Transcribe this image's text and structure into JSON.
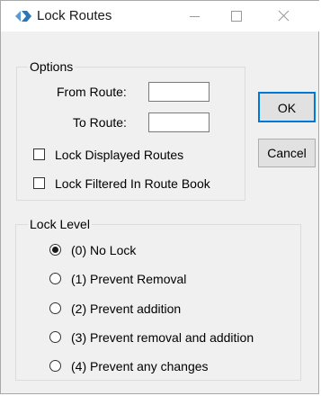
{
  "window": {
    "title": "Lock Routes",
    "icon": "diamond-arrow-icon",
    "controls": {
      "minimize": "minimize-icon",
      "maximize": "maximize-icon",
      "close": "close-icon"
    }
  },
  "options": {
    "legend": "Options",
    "from_route_label": "From Route:",
    "from_route_value": "",
    "to_route_label": "To Route:",
    "to_route_value": "",
    "lock_displayed_label": "Lock Displayed Routes",
    "lock_displayed_checked": false,
    "lock_filtered_label": "Lock Filtered In Route Book",
    "lock_filtered_checked": false
  },
  "buttons": {
    "ok_label": "OK",
    "cancel_label": "Cancel"
  },
  "lock_level": {
    "legend": "Lock Level",
    "selected_index": 0,
    "items": [
      {
        "label": "(0) No Lock"
      },
      {
        "label": "(1) Prevent Removal"
      },
      {
        "label": "(2) Prevent addition"
      },
      {
        "label": "(3) Prevent removal and addition"
      },
      {
        "label": "(4) Prevent any changes"
      }
    ]
  },
  "colors": {
    "dialog_bg": "#f0f0f0",
    "titlebar_bg": "#ffffff",
    "icon_blue": "#3a86c8",
    "default_button_border": "#0078d7"
  }
}
